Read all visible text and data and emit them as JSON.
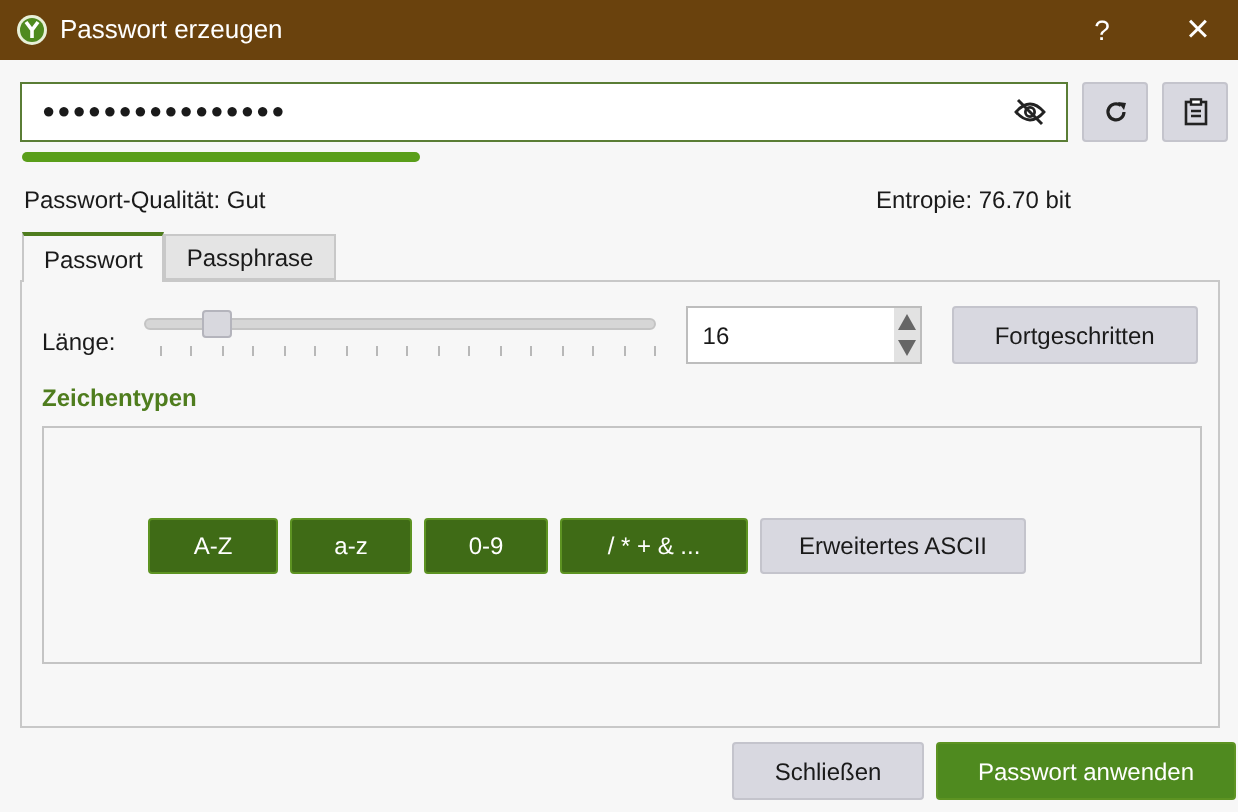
{
  "window": {
    "title": "Passwort erzeugen",
    "help": "?",
    "close": "×"
  },
  "password": {
    "value": "●●●●●●●●●●●●●●●●"
  },
  "quality_label": "Passwort-Qualität: Gut",
  "entropy_label": "Entropie: 76.70 bit",
  "tabs": [
    {
      "label": "Passwort",
      "selected": true
    },
    {
      "label": "Passphrase",
      "selected": false
    }
  ],
  "length": {
    "label": "Länge:",
    "level": 0.14,
    "value": "16"
  },
  "advanced_button": "Fortgeschritten",
  "section_title": "Zeichentypen",
  "char_types": [
    {
      "label": "A-Z",
      "selected": true
    },
    {
      "label": "a-z",
      "selected": true
    },
    {
      "label": "0-9",
      "selected": true
    },
    {
      "label": "/ * + & ...",
      "selected": true
    },
    {
      "label": "Erweitertes ASCII",
      "selected": false
    }
  ],
  "buttons": [
    {
      "label": "Schließen",
      "kind": "secondary"
    },
    {
      "label": "Passwort anwenden",
      "kind": "primary"
    }
  ]
}
